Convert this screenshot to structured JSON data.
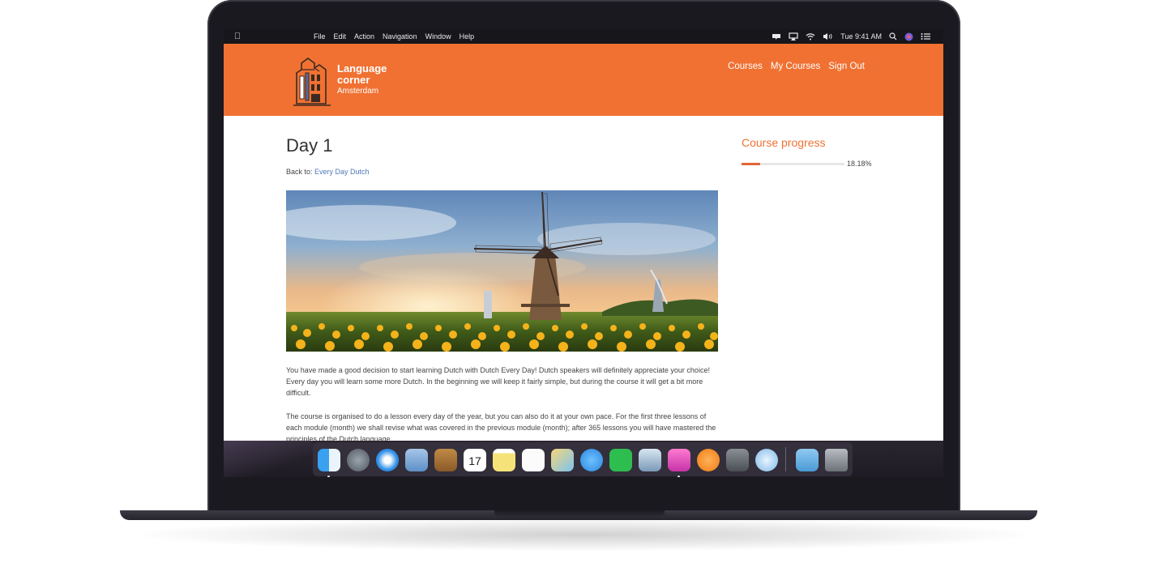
{
  "menubar": {
    "menus": [
      "File",
      "Edit",
      "Action",
      "Navigation",
      "Window",
      "Help"
    ],
    "clock": "Tue 9:41 AM"
  },
  "site": {
    "logo": {
      "line1": "Language",
      "line2": "corner",
      "line3": "Amsterdam"
    },
    "nav": [
      "Courses",
      "My Courses",
      "Sign Out"
    ]
  },
  "lesson": {
    "title": "Day 1",
    "back_prefix": "Back to:",
    "back_link": "Every Day Dutch",
    "paragraphs": [
      "You have made a good decision to start learning Dutch with Dutch Every Day! Dutch speakers will definitely appreciate your choice! Every day you will learn some more Dutch. In the beginning we will keep it fairly simple, but during the course it will get a bit more difficult.",
      "The course is organised to do a lesson every day of the year, but you can also do it at your own pace. For the first three lessons of each module (month) we shall revise what was covered in the previous module (month); after 365 lessons you will have mastered the principles of the Dutch language."
    ]
  },
  "sidebar": {
    "progress_title": "Course progress",
    "progress_value": 18.18,
    "progress_label": "18.18%"
  },
  "dock": {
    "calendar_day": "17",
    "apps": [
      "finder-icon",
      "launchpad-icon",
      "safari-icon",
      "mail-icon",
      "contacts-icon",
      "calendar-icon",
      "notes-icon",
      "reminders-icon",
      "photos-icon",
      "messages-icon",
      "facetime-icon",
      "preview-icon",
      "itunes-icon",
      "ibooks-icon",
      "system-preferences-icon",
      "vpn-icon"
    ],
    "folders": [
      "downloads-folder-icon",
      "trash-icon"
    ]
  },
  "colors": {
    "brand": "#f07132",
    "link": "#4f7ab8",
    "progress": "#e2653a"
  }
}
